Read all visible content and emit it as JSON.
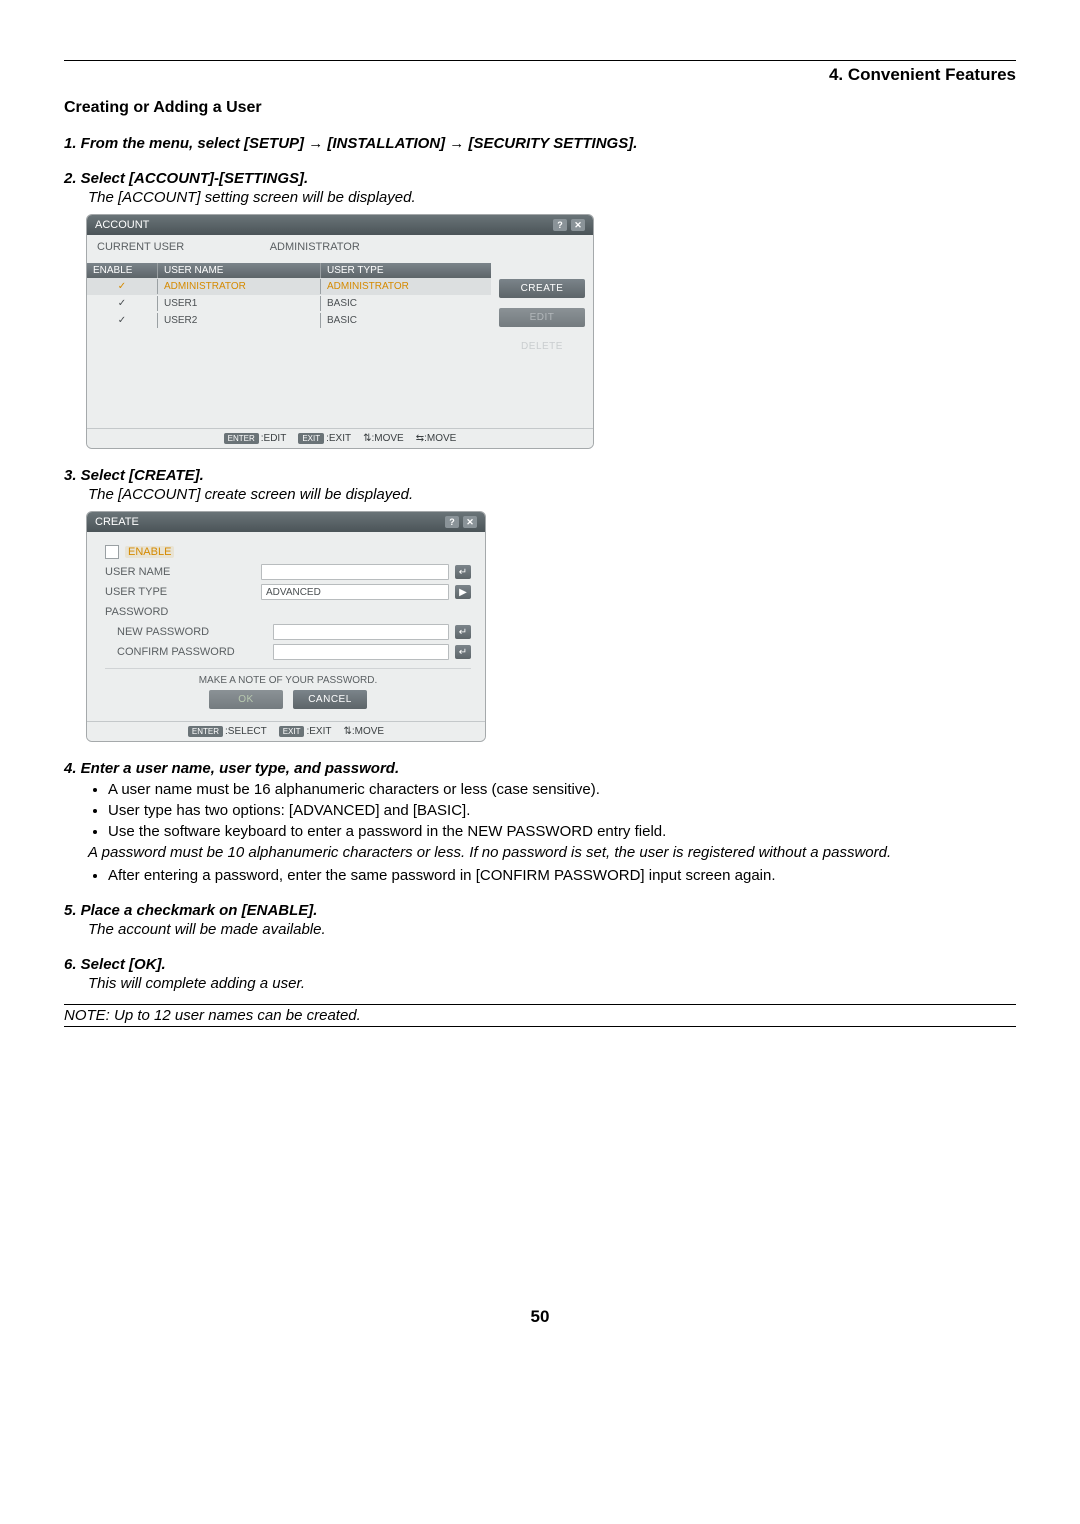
{
  "chapter": "4. Convenient Features",
  "section_title": "Creating or Adding a User",
  "steps": {
    "s1": "1.  From the menu, select [SETUP] → [INSTALLATION] → [SECURITY SETTINGS].",
    "s2": "2.  Select [ACCOUNT]-[SETTINGS].",
    "s2_result": "The [ACCOUNT] setting screen will be displayed.",
    "s3": "3.  Select [CREATE].",
    "s3_result": "The [ACCOUNT] create screen will be displayed.",
    "s4": "4.  Enter a user name, user type, and password.",
    "s4_bullets": [
      "A user name must be 16 alphanumeric characters or less (case sensitive).",
      "User type has two options: [ADVANCED] and [BASIC].",
      "Use the software keyboard to enter a password in the NEW PASSWORD entry field."
    ],
    "s4_note": "A password must be 10 alphanumeric characters or less. If no password is set, the user is registered without a password.",
    "s4_bullet2": "After entering a password, enter the same password in [CONFIRM PASSWORD] input screen again.",
    "s5": "5.  Place a checkmark on [ENABLE].",
    "s5_result": "The account will be made available.",
    "s6": "6.  Select [OK].",
    "s6_result": "This will complete adding a user."
  },
  "note": "NOTE: Up to 12 user names can be created.",
  "page_number": "50",
  "account_window": {
    "title": "ACCOUNT",
    "help_icon": "?",
    "close_icon": "✕",
    "current_user_label": "CURRENT USER",
    "current_user_value": "ADMINISTRATOR",
    "cols": {
      "enable": "ENABLE",
      "user_name": "USER NAME",
      "user_type": "USER TYPE"
    },
    "rows": [
      {
        "en": "✓",
        "un": "ADMINISTRATOR",
        "ut": "ADMINISTRATOR",
        "sel": true
      },
      {
        "en": "✓",
        "un": "USER1",
        "ut": "BASIC",
        "sel": false
      },
      {
        "en": "✓",
        "un": "USER2",
        "ut": "BASIC",
        "sel": false
      }
    ],
    "buttons": {
      "create": "CREATE",
      "edit": "EDIT",
      "delete": "DELETE"
    },
    "footer": {
      "enter_label": "ENTER",
      "enter_action": ":EDIT",
      "exit_label": "EXIT",
      "exit_action": ":EXIT",
      "move_v": "⇅:MOVE",
      "move_h": "⇆:MOVE"
    }
  },
  "create_window": {
    "title": "CREATE",
    "help_icon": "?",
    "close_icon": "✕",
    "enable_label": "ENABLE",
    "user_name_label": "USER NAME",
    "user_type_label": "USER TYPE",
    "user_type_value": "ADVANCED",
    "password_label": "PASSWORD",
    "new_password_label": "NEW PASSWORD",
    "confirm_password_label": "CONFIRM PASSWORD",
    "note": "MAKE A NOTE OF YOUR PASSWORD.",
    "ok": "OK",
    "cancel": "CANCEL",
    "enter_icon": "↵",
    "arrow_icon": "▶",
    "footer": {
      "enter_label": "ENTER",
      "enter_action": ":SELECT",
      "exit_label": "EXIT",
      "exit_action": ":EXIT",
      "move_v": "⇅:MOVE"
    }
  }
}
